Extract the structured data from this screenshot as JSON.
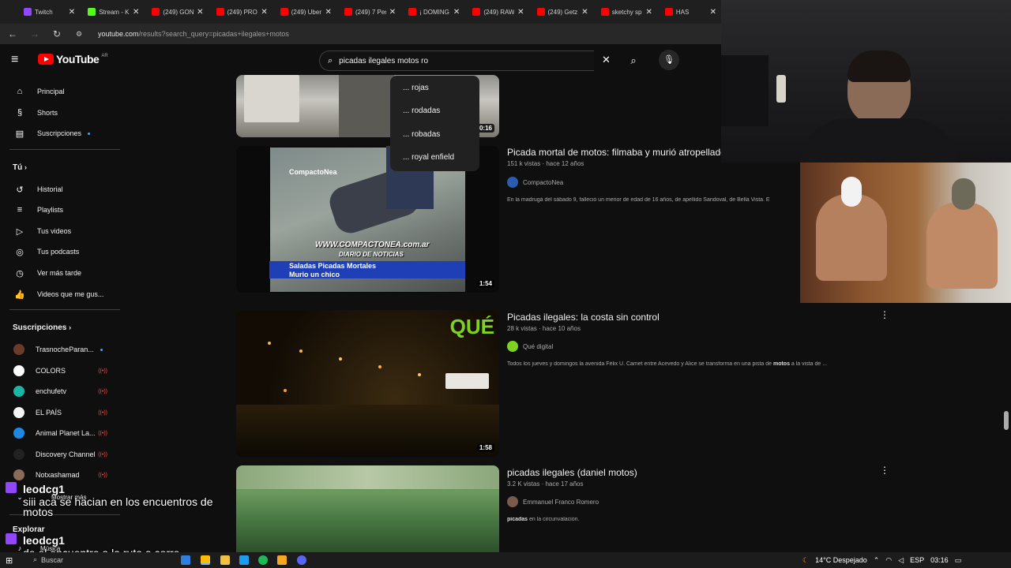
{
  "browser": {
    "tabs": [
      {
        "label": "Twitch",
        "color": "#9147ff"
      },
      {
        "label": "Stream - K",
        "color": "#53fc18"
      },
      {
        "label": "(249) GON",
        "color": "#ff0000"
      },
      {
        "label": "(249) PRO",
        "color": "#ff0000"
      },
      {
        "label": "(249) Uber",
        "color": "#ff0000"
      },
      {
        "label": "(249) 7 Per",
        "color": "#ff0000"
      },
      {
        "label": "¡ DOMING",
        "color": "#ff0000"
      },
      {
        "label": "(249) RAW",
        "color": "#ff0000"
      },
      {
        "label": "(249) Getz",
        "color": "#ff0000"
      },
      {
        "label": "sketchy sp",
        "color": "#ff0000"
      },
      {
        "label": "HAS",
        "color": "#ff0000"
      }
    ],
    "tab_close": "✕",
    "url_host": "youtube.com",
    "url_path": "/results?search_query=picadas+ilegales+motos"
  },
  "youtube": {
    "logo_text": "YouTube",
    "country_code": "AR",
    "search_value": "picadas ilegales motos ro",
    "suggestions": [
      "... rojas",
      "... rodadas",
      "... robadas",
      "... royal enfield"
    ]
  },
  "sidebar": {
    "main": [
      {
        "label": "Principal",
        "icon": "home-icon",
        "glyph": "⌂"
      },
      {
        "label": "Shorts",
        "icon": "shorts-icon",
        "glyph": "§"
      },
      {
        "label": "Suscripciones",
        "icon": "subscriptions-icon",
        "glyph": "▤"
      }
    ],
    "you_heading": "Tú",
    "you": [
      {
        "label": "Historial",
        "icon": "history-icon",
        "glyph": "↺"
      },
      {
        "label": "Playlists",
        "icon": "playlists-icon",
        "glyph": "≡"
      },
      {
        "label": "Tus videos",
        "icon": "your-videos-icon",
        "glyph": "▷"
      },
      {
        "label": "Tus podcasts",
        "icon": "podcasts-icon",
        "glyph": "◎"
      },
      {
        "label": "Ver más tarde",
        "icon": "watch-later-icon",
        "glyph": "◷"
      },
      {
        "label": "Videos que me gus...",
        "icon": "liked-icon",
        "glyph": "👍"
      }
    ],
    "subs_heading": "Suscripciones",
    "subs": [
      {
        "label": "TrasnocheParan...",
        "color": "#6b3b2a",
        "badge": "dot"
      },
      {
        "label": "COLORS",
        "color": "#ffffff",
        "badge": "live"
      },
      {
        "label": "enchufetv",
        "color": "#19b5a5",
        "badge": "live"
      },
      {
        "label": "EL PAÍS",
        "color": "#f5f5f5",
        "badge": "live"
      },
      {
        "label": "Animal Planet La...",
        "color": "#1e88e5",
        "badge": "live"
      },
      {
        "label": "Discovery Channel",
        "color": "#222222",
        "badge": "live"
      },
      {
        "label": "Notxashamad",
        "color": "#8a6b5a",
        "badge": "live"
      }
    ],
    "live_glyph": "((•))",
    "show_more": "Mostrar más",
    "explore_heading": "Explorar",
    "music": "Música"
  },
  "results": [
    {
      "duration": "0:16"
    },
    {
      "title": "Picada mortal de motos: filmaba y murió atropellado",
      "meta": "151 k vistas · hace 12 años",
      "channel": "CompactoNea",
      "channel_color": "#2a5db0",
      "desc": "En la madrugá del sábado 9, falleció un menor de edad de 16 años, de apellido Sandoval, de Bella Vista. E",
      "duration": "1:54",
      "thumb_brand": "CompactoNea",
      "thumb_url": "WWW.COMPACTONEA.com.ar",
      "thumb_sub": "DIARIO DE NOTICIAS",
      "thumb_caption1": "Saladas Picadas Mortales",
      "thumb_caption2": "Murio un chico"
    },
    {
      "title": "Picadas ilegales: la costa sin control",
      "meta": "28 k vistas · hace 10 años",
      "channel": "Qué digital",
      "channel_color": "#7ed321",
      "desc_pre": "Todos los jueves y domingos la avenida Félix U. Camet entre Acevedo y Alice se transforma en una pista de ",
      "desc_bold": "motos",
      "desc_post": " a la vista de ...",
      "duration": "1:58",
      "thumb_brand": "QUÉ"
    },
    {
      "title": "picadas ilegales (daniel motos)",
      "meta": "3.2 K vistas · hace 17 años",
      "channel": "Emmanuel Franco Romero",
      "channel_color": "#7a5a4a",
      "desc_bold": "picadas",
      "desc_post": " en la circunvalacion."
    }
  ],
  "chat": [
    {
      "user": "leodcg1",
      "message1": "siii aca se hacian en los encuentros de",
      "message2": "motos"
    },
    {
      "user": "leodcg1",
      "message1": "de el encuentro a la ruta a corre"
    }
  ],
  "taskbar": {
    "search_placeholder": "Buscar",
    "weather": "14°C  Despejado",
    "lang": "ESP",
    "time": "03:16"
  }
}
